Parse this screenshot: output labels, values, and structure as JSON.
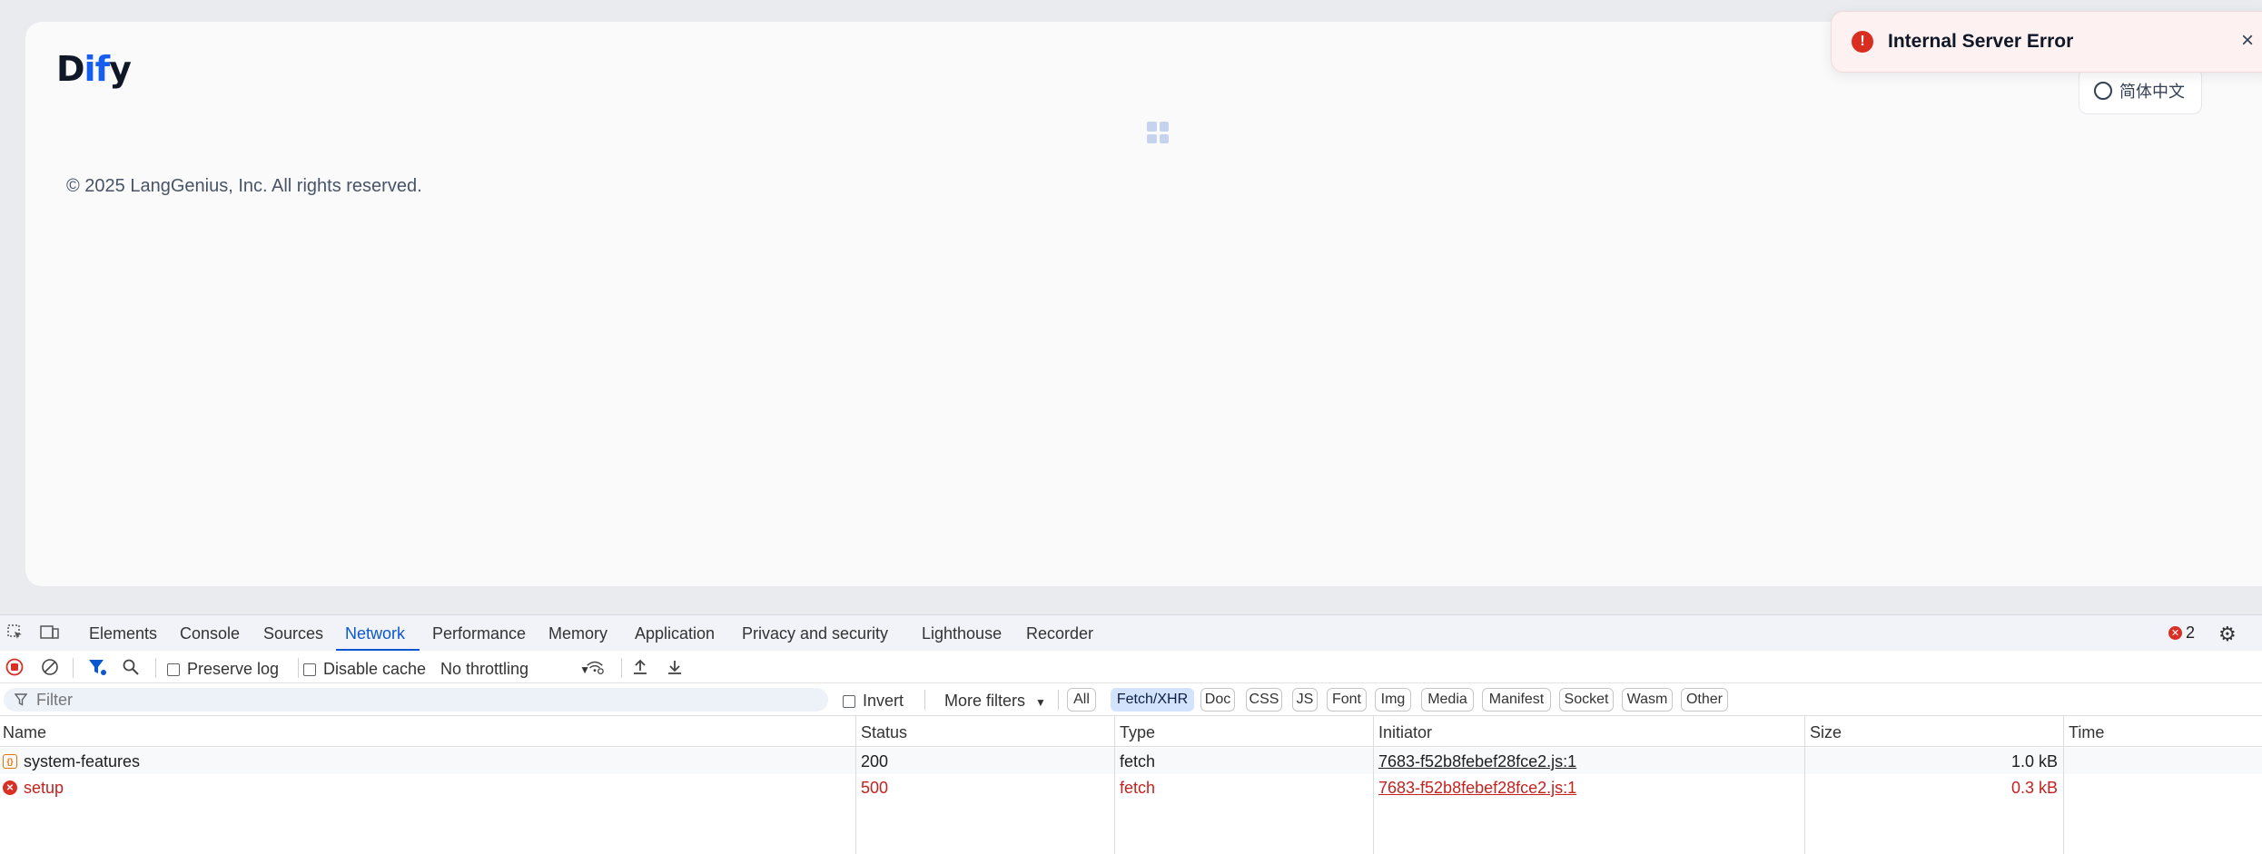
{
  "app": {
    "logo_prefix": "D",
    "logo_accent": "if",
    "logo_suffix": "y",
    "copyright": "© 2025 LangGenius, Inc. All rights reserved.",
    "language_button": "简体中文"
  },
  "toast": {
    "message": "Internal Server Error",
    "close_label": "×"
  },
  "devtools": {
    "tabs": [
      "Elements",
      "Console",
      "Sources",
      "Network",
      "Performance",
      "Memory",
      "Application",
      "Privacy and security",
      "Lighthouse",
      "Recorder"
    ],
    "active_tab": "Network",
    "error_count": "2",
    "toolbar": {
      "preserve_log": "Preserve log",
      "disable_cache": "Disable cache",
      "throttling": "No throttling"
    },
    "filterbar": {
      "filter_placeholder": "Filter",
      "invert": "Invert",
      "more_filters": "More filters",
      "chips": [
        "All",
        "Fetch/XHR",
        "Doc",
        "CSS",
        "JS",
        "Font",
        "Img",
        "Media",
        "Manifest",
        "Socket",
        "Wasm",
        "Other"
      ],
      "active_chip": "Fetch/XHR"
    },
    "table": {
      "headers": [
        "Name",
        "Status",
        "Type",
        "Initiator",
        "Size",
        "Time"
      ],
      "rows": [
        {
          "name": "system-features",
          "status": "200",
          "type": "fetch",
          "initiator": "7683-f52b8febef28fce2.js:1",
          "size": "1.0 kB",
          "time": "",
          "icon": "fetch-icon"
        },
        {
          "name": "setup",
          "status": "500",
          "type": "fetch",
          "initiator": "7683-f52b8febef28fce2.js:1",
          "size": "0.3 kB",
          "time": "",
          "icon": "error-icon"
        }
      ]
    }
  },
  "colors": {
    "accent": "#155eef",
    "devtools_active": "#0b57d0",
    "error_red": "#c5221f"
  }
}
